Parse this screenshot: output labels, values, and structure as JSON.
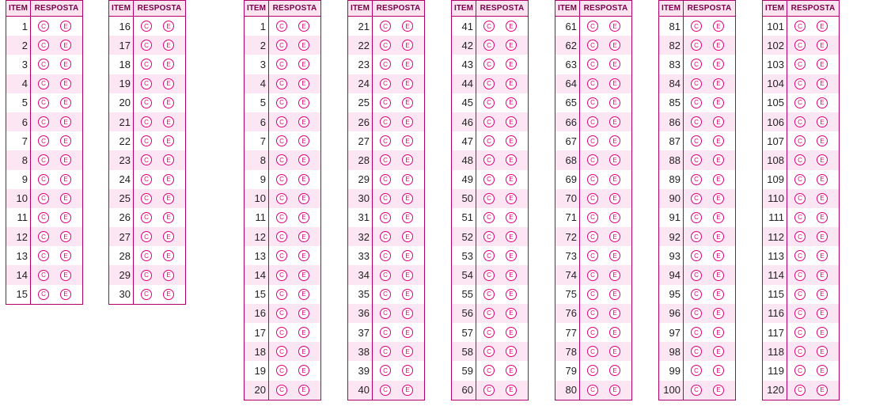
{
  "header": {
    "item": "ITEM",
    "response": "RESPOSTA"
  },
  "bubbles": {
    "c": "C",
    "e": "E"
  },
  "colors": {
    "border": "#b0006a",
    "bubble": "#e0007a",
    "stripe": "#fde6f3"
  },
  "blocks": [
    {
      "start": 1,
      "end": 15
    },
    {
      "start": 16,
      "end": 30
    },
    {
      "start": 1,
      "end": 20
    },
    {
      "start": 21,
      "end": 40
    },
    {
      "start": 41,
      "end": 60
    },
    {
      "start": 61,
      "end": 80
    },
    {
      "start": 81,
      "end": 100
    },
    {
      "start": 101,
      "end": 120
    }
  ]
}
